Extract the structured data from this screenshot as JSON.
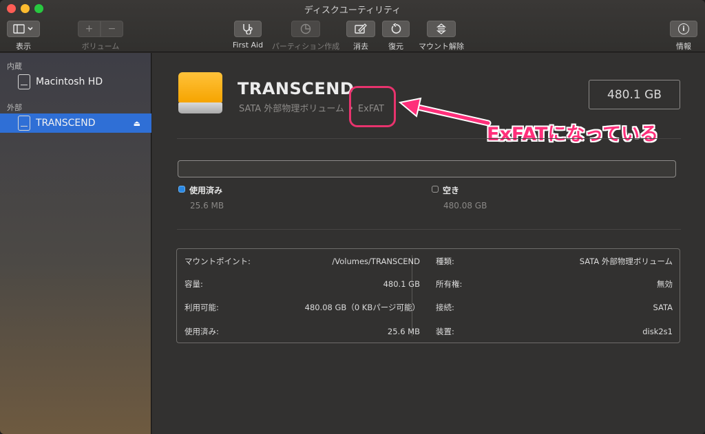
{
  "window": {
    "title": "ディスクユーティリティ"
  },
  "toolbar": {
    "view_label": "表示",
    "volume_label": "ボリューム",
    "volume_add": "+",
    "volume_remove": "−",
    "firstaid_label": "First Aid",
    "partition_label": "パーティション作成",
    "erase_label": "消去",
    "restore_label": "復元",
    "unmount_label": "マウント解除",
    "info_label": "情報",
    "info_glyph": "i"
  },
  "sidebar": {
    "section_internal": "内蔵",
    "section_external": "外部",
    "items": [
      {
        "label": "Macintosh HD"
      },
      {
        "label": "TRANSCEND",
        "selected": true
      }
    ]
  },
  "volume": {
    "name": "TRANSCEND",
    "description": "SATA 外部物理ボリューム",
    "format": "ExFAT",
    "separator": "•",
    "capacity": "480.1 GB"
  },
  "annotation": {
    "text": "ExFATになっている",
    "color": "#ff2f7a"
  },
  "usage": {
    "used_label": "使用済み",
    "used_value": "25.6 MB",
    "free_label": "空き",
    "free_value": "480.08 GB",
    "used_color": "#2a88e3"
  },
  "info": {
    "left": [
      {
        "label": "マウントポイント:",
        "value": "/Volumes/TRANSCEND"
      },
      {
        "label": "容量:",
        "value": "480.1 GB"
      },
      {
        "label": "利用可能:",
        "value": "480.08 GB（0 KBパージ可能）"
      },
      {
        "label": "使用済み:",
        "value": "25.6 MB"
      }
    ],
    "right": [
      {
        "label": "種類:",
        "value": "SATA 外部物理ボリューム"
      },
      {
        "label": "所有権:",
        "value": "無効"
      },
      {
        "label": "接続:",
        "value": "SATA"
      },
      {
        "label": "装置:",
        "value": "disk2s1"
      }
    ]
  }
}
